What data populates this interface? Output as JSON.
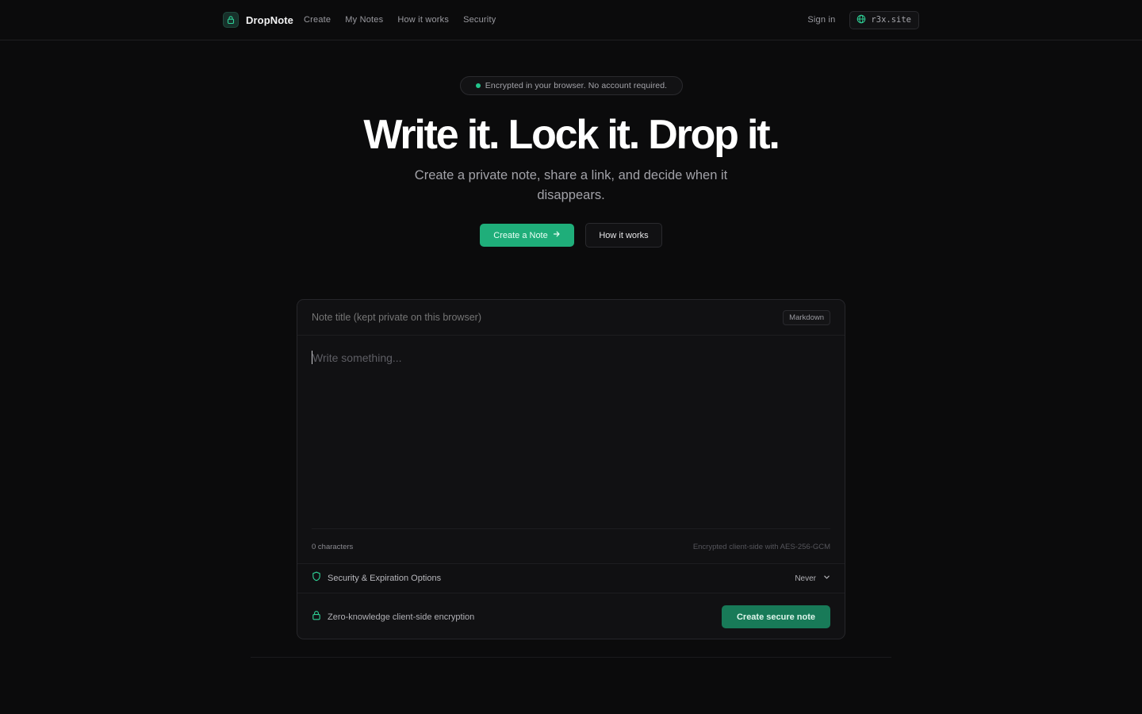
{
  "nav": {
    "brand": "DropNote",
    "links": [
      "Create",
      "My Notes",
      "How it works",
      "Security"
    ],
    "sign_in": "Sign in",
    "site": "r3x.site"
  },
  "hero": {
    "badge": "Encrypted in your browser. No account required.",
    "title": "Write it. Lock it. Drop it.",
    "subtitle": "Create a private note, share a link, and decide when it disappears.",
    "primary_cta": "Create a Note",
    "secondary_cta": "How it works"
  },
  "editor": {
    "title_placeholder": "Note title (kept private on this browser)",
    "mode_chip": "Markdown",
    "body_placeholder": "Write something...",
    "char_count": "0 characters",
    "encryption_note": "Encrypted client-side with AES-256-GCM",
    "security_label": "Security & Expiration Options",
    "expiration_value": "Never",
    "zk_label": "Zero-knowledge client-side encryption",
    "submit_label": "Create secure note"
  },
  "colors": {
    "accent": "#1fae7a",
    "accent_dark": "#187a58",
    "background": "#0b0b0c",
    "card": "#111113"
  },
  "icons": {
    "brand": "lock-icon",
    "site": "globe-icon",
    "cta_arrow": "arrow-right-icon",
    "security": "shield-icon",
    "expire": "chevron-down-icon",
    "zk": "lock-icon"
  }
}
